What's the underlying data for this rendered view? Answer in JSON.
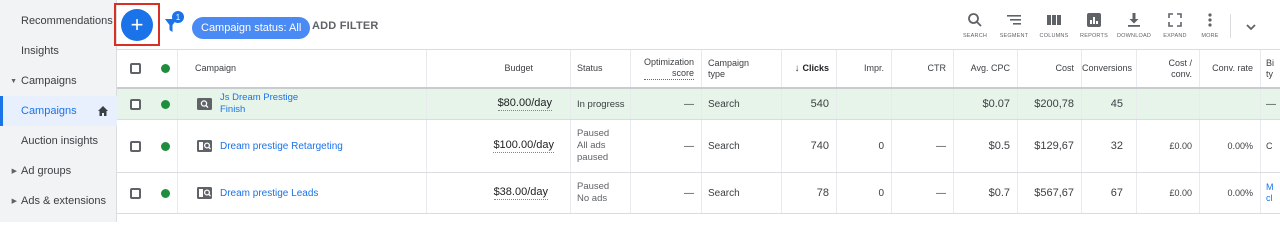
{
  "sidebar": {
    "items": [
      {
        "label": "Recommendations"
      },
      {
        "label": "Insights"
      },
      {
        "label": "Campaigns"
      },
      {
        "label": "Campaigns"
      },
      {
        "label": "Auction insights"
      },
      {
        "label": "Ad groups"
      },
      {
        "label": "Ads & extensions"
      }
    ]
  },
  "toolbar": {
    "add_label": "+",
    "filter_badge": "1",
    "status_chip": "Campaign status: All",
    "add_filter": "ADD FILTER",
    "tools": [
      {
        "label": "SEARCH",
        "icon": "search-icon"
      },
      {
        "label": "SEGMENT",
        "icon": "segment-icon"
      },
      {
        "label": "COLUMNS",
        "icon": "columns-icon"
      },
      {
        "label": "REPORTS",
        "icon": "reports-icon"
      },
      {
        "label": "DOWNLOAD",
        "icon": "download-icon"
      },
      {
        "label": "EXPAND",
        "icon": "expand-icon"
      },
      {
        "label": "MORE",
        "icon": "more-icon"
      }
    ]
  },
  "table": {
    "headers": {
      "campaign": "Campaign",
      "budget": "Budget",
      "status": "Status",
      "opt1": "Optimization",
      "opt2": "score",
      "ctype1": "Campaign",
      "ctype2": "type",
      "clicks": "Clicks",
      "impr": "Impr.",
      "ctr": "CTR",
      "avgcpc": "Avg. CPC",
      "cost": "Cost",
      "conv": "Conversions",
      "costconv1": "Cost /",
      "costconv2": "conv.",
      "convrate": "Conv. rate",
      "bid1": "Bi",
      "bid2": "ty"
    },
    "rows": [
      {
        "name1": "Js Dream Prestige",
        "name2": "Finish",
        "budget": "$80.00/day",
        "status1": "In progress",
        "status2": "",
        "status3": "",
        "opt": "—",
        "type": "Search",
        "clicks": "540",
        "impr": "",
        "ctr": "",
        "avgcpc": "$0.07",
        "cost": "$200,78",
        "conv": "45",
        "costconv": "",
        "convrate": "",
        "bid1": "—",
        "bid2": ""
      },
      {
        "name1": "Dream prestige Retargeting",
        "name2": "",
        "budget": "$100.00/day",
        "status1": "Paused",
        "status2": "All ads",
        "status3": "paused",
        "opt": "—",
        "type": "Search",
        "clicks": "740",
        "impr": "0",
        "ctr": "—",
        "avgcpc": "$0.5",
        "cost": "$129,67",
        "conv": "32",
        "costconv": "£0.00",
        "convrate": "0.00%",
        "bid1": "C",
        "bid2": ""
      },
      {
        "name1": "Dream prestige Leads",
        "name2": "",
        "budget": "$38.00/day",
        "status1": "Paused",
        "status2": "No ads",
        "status3": "",
        "opt": "—",
        "type": "Search",
        "clicks": "78",
        "impr": "0",
        "ctr": "—",
        "avgcpc": "$0.7",
        "cost": "$567,67",
        "conv": "67",
        "costconv": "£0.00",
        "convrate": "0.00%",
        "bid1": "M",
        "bid2": "cl"
      }
    ]
  },
  "colors": {
    "accent": "#1a73e8",
    "status_enabled": "#1e8e3e",
    "highlight_row": "#e6f4ea",
    "annotation_frame": "#d93025"
  }
}
